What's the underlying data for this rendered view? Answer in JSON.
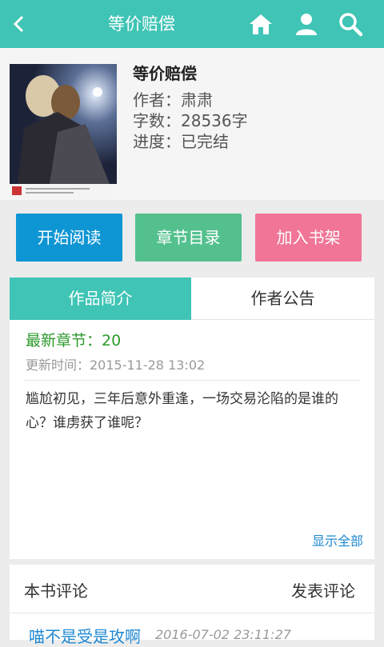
{
  "header": {
    "back_icon": "back-arrow-icon",
    "title": "等价赔偿",
    "icons": [
      "home-icon",
      "user-icon",
      "search-icon"
    ],
    "color": "#3fc4b5"
  },
  "book": {
    "title": "等价赔偿",
    "author_label": "作者：肃肃",
    "words_label": "字数：28536字",
    "progress_label": "进度：已完结"
  },
  "actions": {
    "read": "开始阅读",
    "catalog": "章节目录",
    "shelf": "加入书架",
    "colors": {
      "read": "#0e95d3",
      "catalog": "#53c08e",
      "shelf": "#f07597"
    }
  },
  "tabs": {
    "intro": "作品简介",
    "notice": "作者公告"
  },
  "intro": {
    "latest": "最新章节：20",
    "updated": "更新时间：2015-11-28 13:02",
    "summary": "尴尬初见，三年后意外重逢，一场交易沦陷的是谁的心？谁虏获了谁呢？",
    "show_all": "显示全部"
  },
  "comments": {
    "title": "本书评论",
    "post": "发表评论",
    "first_user": "喵不是受是攻啊",
    "first_time": "2016-07-02 23:11:27"
  }
}
